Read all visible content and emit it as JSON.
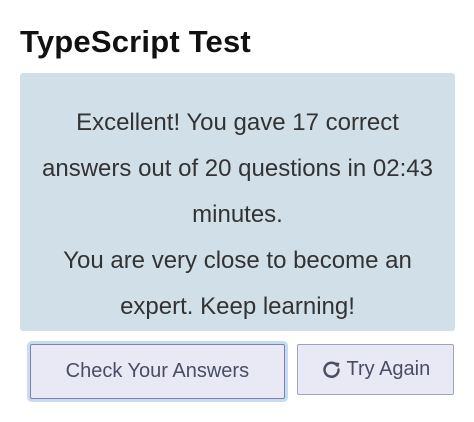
{
  "header": {
    "title": "TypeScript Test"
  },
  "result": {
    "line1": "Excellent! You gave 17 correct answers out of 20 questions in 02:43 minutes.",
    "line2": "You are very close to become an expert. Keep learning!"
  },
  "actions": {
    "check_label": "Check Your Answers",
    "retry_label": "Try Again",
    "retry_icon": "redo-icon"
  },
  "colors": {
    "panel_background": "#d1dfe9",
    "button_background": "#e8e9f5",
    "button_border": "#9ea3c2",
    "focus_ring": "#c6dcf5"
  }
}
